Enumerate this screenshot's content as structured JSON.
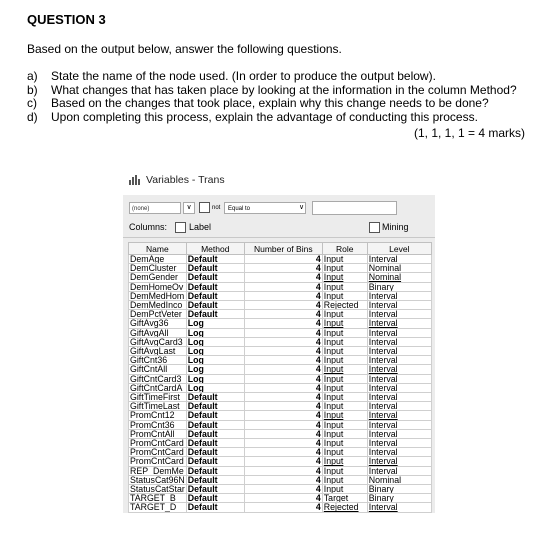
{
  "question": {
    "heading": "QUESTION 3",
    "intro": "Based on the output below, answer the following questions.",
    "items": [
      {
        "letter": "a)",
        "text": "State the name of the node used. (In order to produce the output below)."
      },
      {
        "letter": "b)",
        "text": "What changes that has taken place by looking at the information in the column Method?"
      },
      {
        "letter": "c)",
        "text": "Based on the changes that took place, explain why this change needs to be done?"
      },
      {
        "letter": "d)",
        "text": "Upon completing this process, explain the advantage of conducting this process."
      }
    ],
    "marks": "(1, 1, 1, 1 = 4 marks)"
  },
  "window": {
    "title": "Variables - Trans",
    "filter": {
      "column_select": "(none)",
      "not_label": "not",
      "operator_select": "Equal to",
      "value": ""
    },
    "columns_label": "Columns:",
    "label_checkbox": "Label",
    "mining_checkbox": "Mining",
    "table": {
      "headers": [
        "Name",
        "Method",
        "Number of Bins",
        "Role",
        "Level"
      ],
      "rows": [
        [
          "DemAge",
          "Default",
          "4",
          "Input",
          "Interval"
        ],
        [
          "DemCluster",
          "Default",
          "4",
          "Input",
          "Nominal"
        ],
        [
          "DemGender",
          "Default",
          "4",
          "Input",
          "Nominal"
        ],
        [
          "DemHomeOv",
          "Default",
          "4",
          "Input",
          "Binary"
        ],
        [
          "DemMedHom",
          "Default",
          "4",
          "Input",
          "Interval"
        ],
        [
          "DemMedInco",
          "Default",
          "4",
          "Rejected",
          "Interval"
        ],
        [
          "DemPctVeter",
          "Default",
          "4",
          "Input",
          "Interval"
        ],
        [
          "GiftAvg36",
          "Log",
          "4",
          "Input",
          "Interval"
        ],
        [
          "GiftAvgAll",
          "Log",
          "4",
          "Input",
          "Interval"
        ],
        [
          "GiftAvgCard3",
          "Log",
          "4",
          "Input",
          "Interval"
        ],
        [
          "GiftAvgLast",
          "Log",
          "4",
          "Input",
          "Interval"
        ],
        [
          "GiftCnt36",
          "Log",
          "4",
          "Input",
          "Interval"
        ],
        [
          "GiftCntAll",
          "Log",
          "4",
          "Input",
          "Interval"
        ],
        [
          "GiftCntCard3",
          "Log",
          "4",
          "Input",
          "Interval"
        ],
        [
          "GiftCntCardA",
          "Log",
          "4",
          "Input",
          "Interval"
        ],
        [
          "GiftTimeFirst",
          "Default",
          "4",
          "Input",
          "Interval"
        ],
        [
          "GiftTimeLast",
          "Default",
          "4",
          "Input",
          "Interval"
        ],
        [
          "PromCnt12",
          "Default",
          "4",
          "Input",
          "Interval"
        ],
        [
          "PromCnt36",
          "Default",
          "4",
          "Input",
          "Interval"
        ],
        [
          "PromCntAll",
          "Default",
          "4",
          "Input",
          "Interval"
        ],
        [
          "PromCntCard",
          "Default",
          "4",
          "Input",
          "Interval"
        ],
        [
          "PromCntCard",
          "Default",
          "4",
          "Input",
          "Interval"
        ],
        [
          "PromCntCard",
          "Default",
          "4",
          "Input",
          "Interval"
        ],
        [
          "REP_DemMe",
          "Default",
          "4",
          "Input",
          "Interval"
        ],
        [
          "StatusCat96N",
          "Default",
          "4",
          "Input",
          "Nominal"
        ],
        [
          "StatusCatStar",
          "Default",
          "4",
          "Input",
          "Binary"
        ],
        [
          "TARGET_B",
          "Default",
          "4",
          "Target",
          "Binary"
        ],
        [
          "TARGET_D",
          "Default",
          "4",
          "Rejected",
          "Interval"
        ]
      ]
    }
  }
}
